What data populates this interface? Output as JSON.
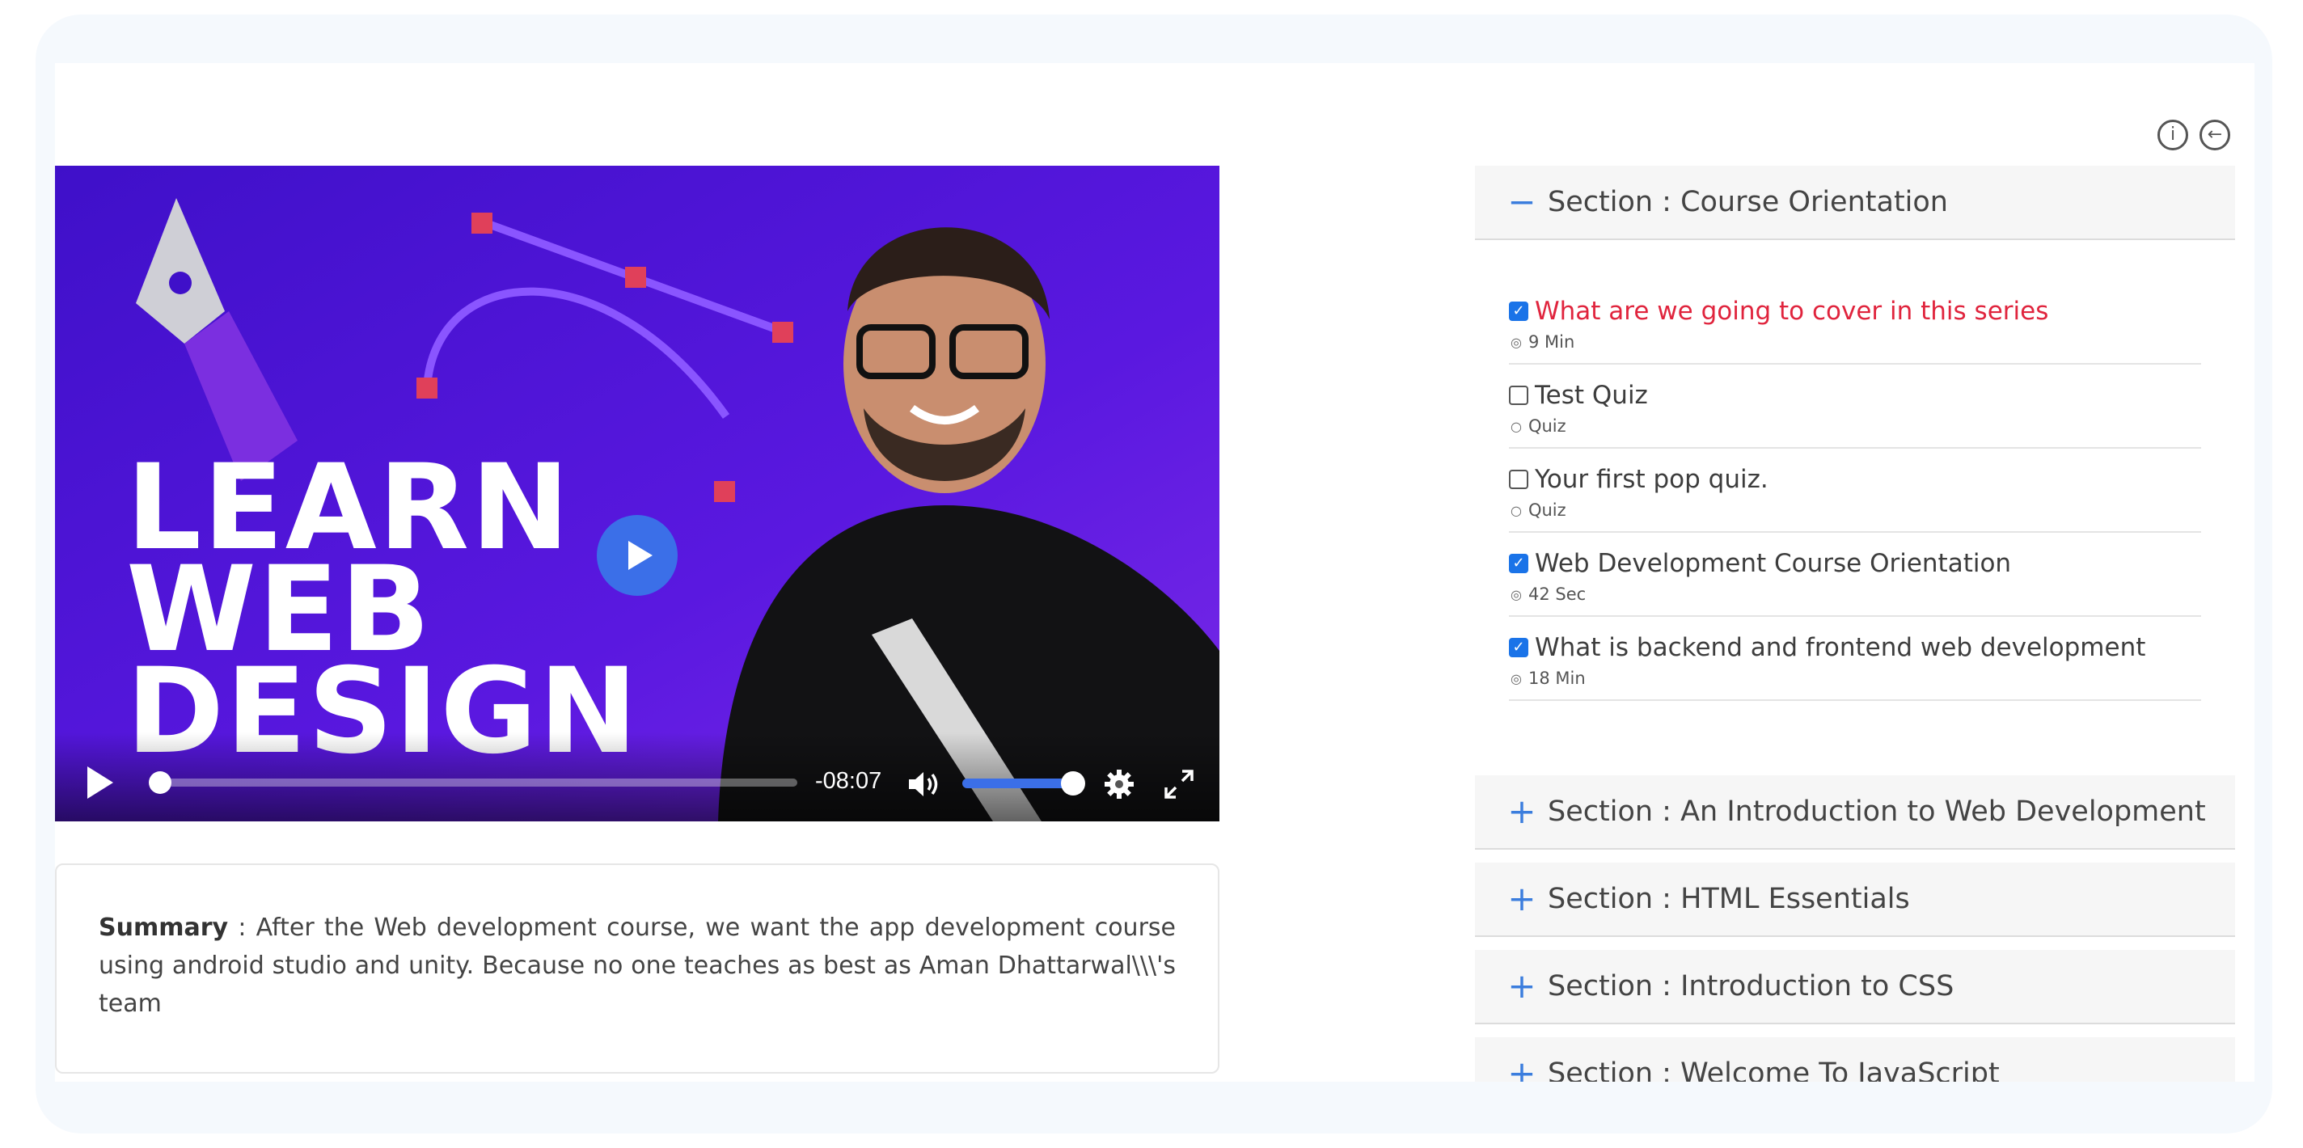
{
  "top_icons": {
    "info": "i",
    "back": "←"
  },
  "video": {
    "thumbnail_lines": [
      "LEARN",
      "WEB",
      "DESIGN"
    ],
    "time_remaining": "-08:07",
    "progress": 0.0,
    "volume": 1.0
  },
  "summary": {
    "label": "Summary",
    "text": " : After the Web development course, we want the app development course using android studio and unity. Because no one teaches as best as Aman Dhattarwal\\\\\\'s team"
  },
  "sections": {
    "open": {
      "title": "Section : Course Orientation",
      "sign": "−",
      "lessons": [
        {
          "title": "What are we going to cover in this series",
          "meta": "9 Min",
          "icon": "◎",
          "checked": true,
          "active": true
        },
        {
          "title": "Test Quiz",
          "meta": "Quiz",
          "icon": "○",
          "checked": false,
          "active": false
        },
        {
          "title": "Your first pop quiz.",
          "meta": "Quiz",
          "icon": "○",
          "checked": false,
          "active": false
        },
        {
          "title": "Web Development Course Orientation",
          "meta": "42 Sec",
          "icon": "◎",
          "checked": true,
          "active": false
        },
        {
          "title": "What is backend and frontend web development",
          "meta": "18 Min",
          "icon": "◎",
          "checked": true,
          "active": false
        }
      ]
    },
    "collapsed": [
      {
        "title": "Section : An Introduction to Web Development",
        "sign": "+"
      },
      {
        "title": "Section : HTML Essentials",
        "sign": "+"
      },
      {
        "title": "Section : Introduction to CSS",
        "sign": "+"
      },
      {
        "title": "Section : Welcome To JavaScript",
        "sign": "+"
      }
    ]
  },
  "colors": {
    "accent": "#3b7ddd",
    "active_lesson": "#e0243d",
    "video_bg": "#4a12d6"
  }
}
